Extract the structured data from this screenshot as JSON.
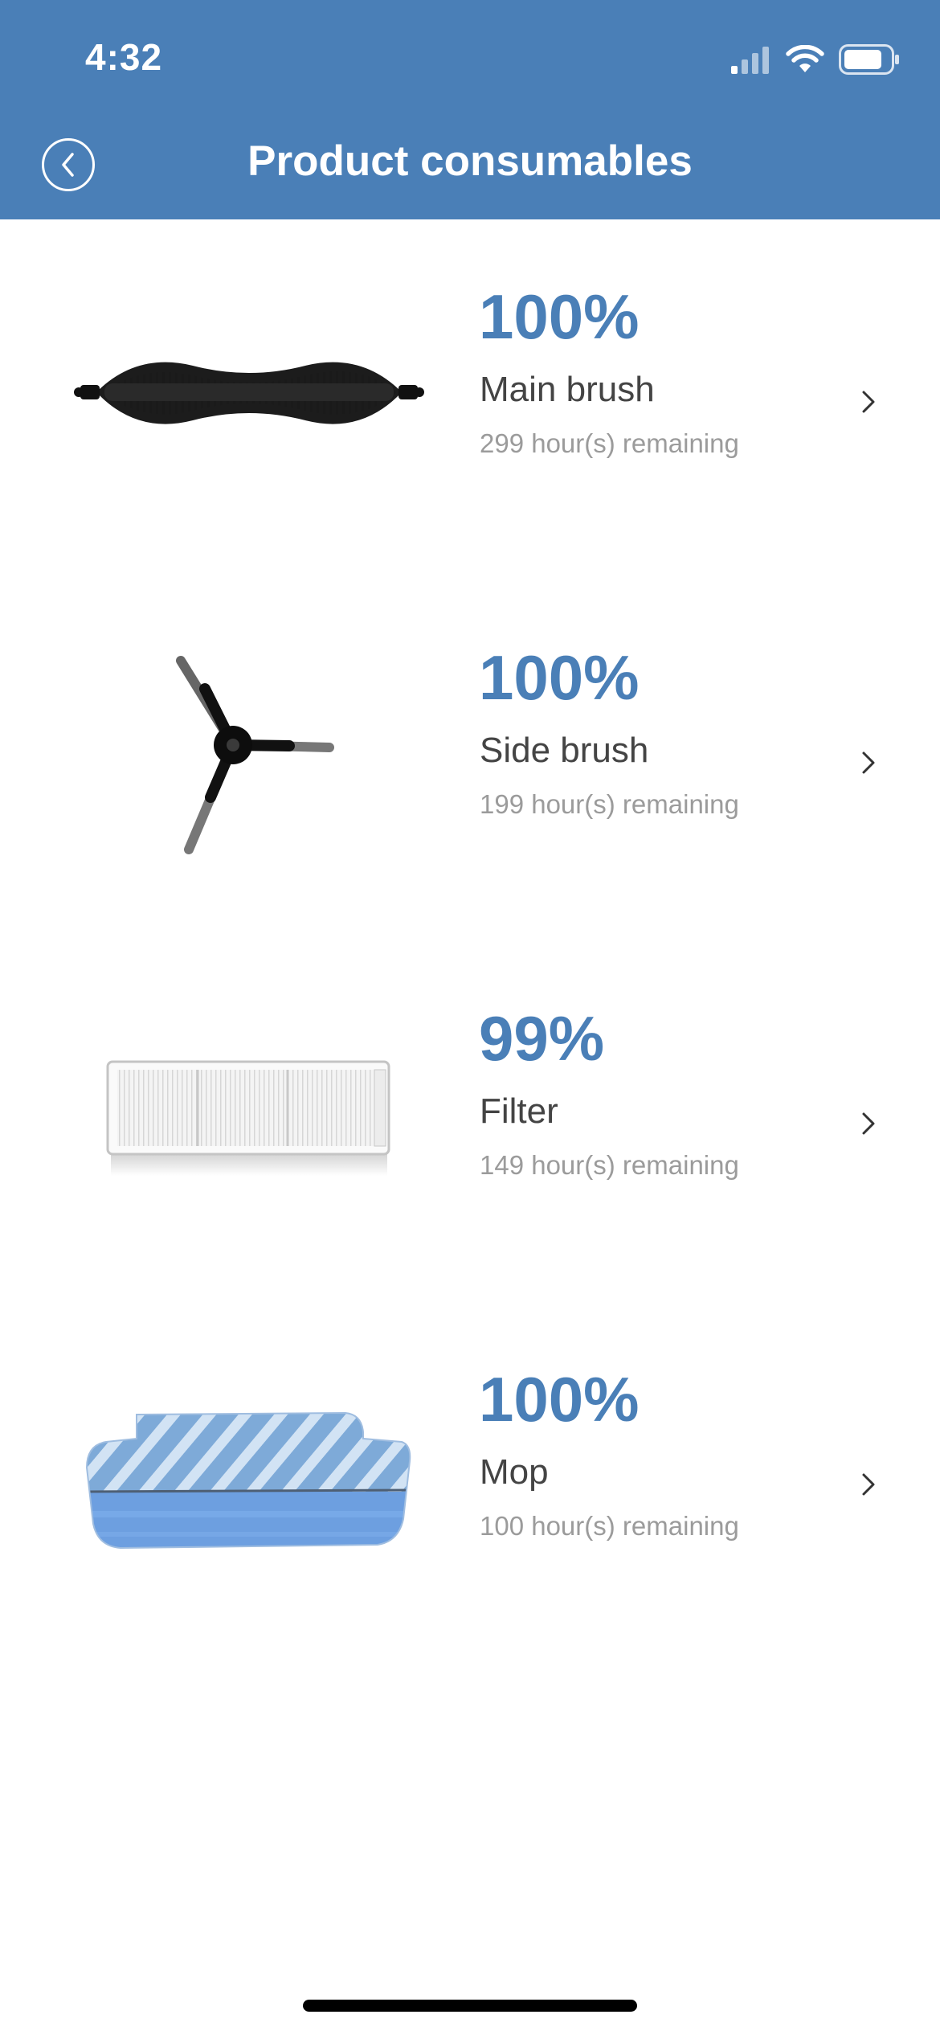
{
  "status_bar": {
    "time": "4:32",
    "icons": [
      "cellular-signal-icon",
      "wifi-icon",
      "battery-icon"
    ]
  },
  "header": {
    "title": "Product consumables",
    "back_icon": "chevron-left-circle-icon",
    "background": "#4a7fb7"
  },
  "consumables": [
    {
      "percent": "100%",
      "name": "Main brush",
      "remaining": "299 hour(s) remaining",
      "image": "main-brush"
    },
    {
      "percent": "100%",
      "name": "Side brush",
      "remaining": "199 hour(s) remaining",
      "image": "side-brush"
    },
    {
      "percent": "99%",
      "name": "Filter",
      "remaining": "149 hour(s) remaining",
      "image": "filter"
    },
    {
      "percent": "100%",
      "name": "Mop",
      "remaining": "100 hour(s) remaining",
      "image": "mop"
    }
  ],
  "colors": {
    "accent": "#4a7fb7",
    "name_text": "#444444",
    "secondary_text": "#9b9b9b"
  }
}
